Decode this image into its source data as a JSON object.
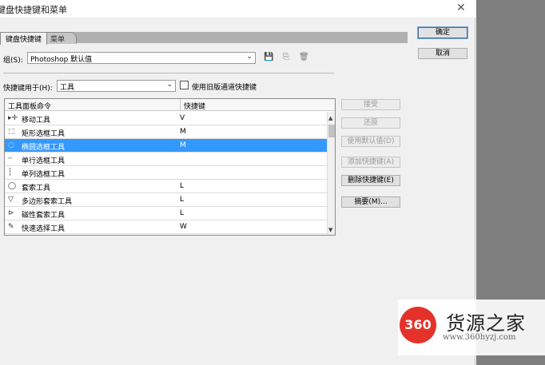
{
  "window": {
    "title": "键盘快捷键和菜单",
    "close_glyph": "✕"
  },
  "tabs": [
    {
      "label": "键盘快捷键",
      "active": true
    },
    {
      "label": "菜单",
      "active": false
    }
  ],
  "group": {
    "label": "组(S):",
    "value": "Photoshop 默认值"
  },
  "shortcuts_for": {
    "label": "快捷键用于(H):",
    "value": "工具"
  },
  "legacy_checkbox": {
    "label": "使用旧版通道快捷键",
    "checked": false
  },
  "table": {
    "columns": [
      "工具面板命令",
      "快捷键"
    ],
    "rows": [
      {
        "icon": "move-tool-icon",
        "glyph": "▸✛",
        "name": "移动工具",
        "key": "V",
        "selected": false
      },
      {
        "icon": "rect-marquee-icon",
        "glyph": "⬚",
        "name": "矩形选框工具",
        "key": "M",
        "selected": false
      },
      {
        "icon": "ellipse-marquee-icon",
        "glyph": "◌",
        "name": "椭圆选框工具",
        "key": "M",
        "selected": true
      },
      {
        "icon": "single-row-marquee-icon",
        "glyph": "┄",
        "name": "单行选框工具",
        "key": "",
        "selected": false
      },
      {
        "icon": "single-column-marquee-icon",
        "glyph": "┆",
        "name": "单列选框工具",
        "key": "",
        "selected": false
      },
      {
        "icon": "lasso-icon",
        "glyph": "◯",
        "name": "套索工具",
        "key": "L",
        "selected": false
      },
      {
        "icon": "polygon-lasso-icon",
        "glyph": "▽",
        "name": "多边形套索工具",
        "key": "L",
        "selected": false
      },
      {
        "icon": "magnetic-lasso-icon",
        "glyph": "⊳",
        "name": "磁性套索工具",
        "key": "L",
        "selected": false
      },
      {
        "icon": "quick-select-icon",
        "glyph": "✎",
        "name": "快速选择工具",
        "key": "W",
        "selected": false
      }
    ]
  },
  "buttons": {
    "ok": "确定",
    "cancel": "取消",
    "accept": "接受",
    "undo": "还原",
    "use_default": "使用默认值(D)",
    "add_shortcut": "添加快捷键(A)",
    "delete_shortcut": "删除快捷键(E)",
    "summary": "摘要(M)..."
  },
  "watermark": {
    "logo_text": "360",
    "title": "货源之家",
    "url": "www.360hyzj.com"
  }
}
